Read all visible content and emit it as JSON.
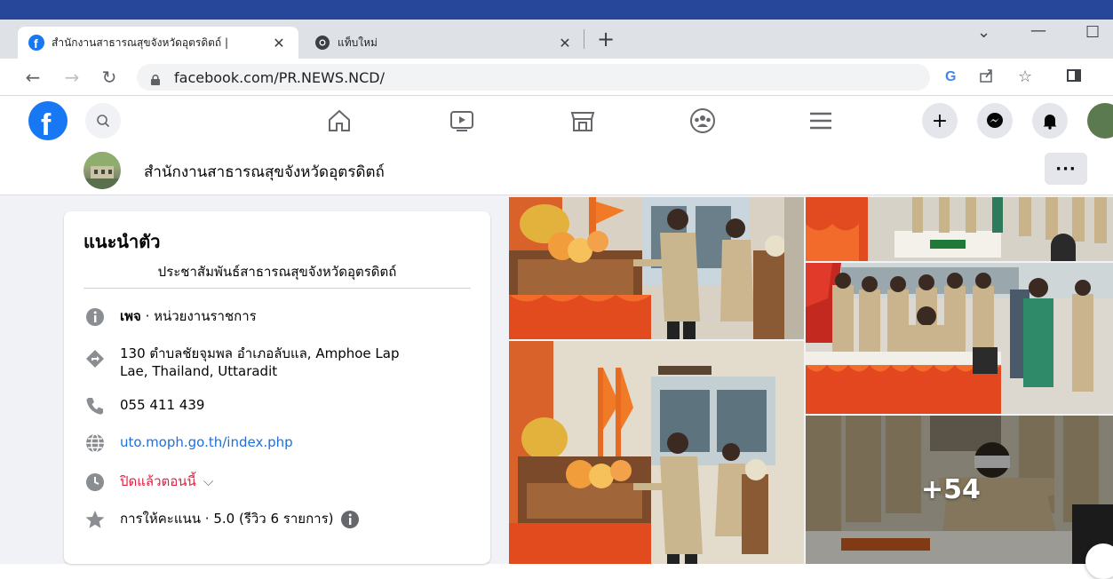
{
  "browser": {
    "tabs": [
      {
        "title": "สำนักงานสาธารณสุขจังหวัดอุตรดิตถ์ |",
        "close": "✕",
        "active": true
      },
      {
        "title": "แท็บใหม่",
        "close": "✕",
        "active": false
      }
    ],
    "new_tab": "+",
    "url": "facebook.com/PR.NEWS.NCD/"
  },
  "page": {
    "name": "สำนักงานสาธารณสุขจังหวัดอุตรดิตถ์",
    "more": "···"
  },
  "intro": {
    "title": "แนะนำตัว",
    "bio": "ประชาสัมพันธ์สาธารณสุขจังหวัดอุตรดิตถ์",
    "category_prefix": "เพจ",
    "category": " · หน่วยงานราชการ",
    "address_line1": "130 ตำบลชัยจุมพล อำเภอลับแล, Amphoe Lap",
    "address_line2": "Lae, Thailand, Uttaradit",
    "phone": "055 411 439",
    "website": "uto.moph.go.th/index.php",
    "hours": "ปิดแล้วตอนนี้",
    "rating": "การให้คะแนน · 5.0 (รีวิว 6 รายการ)"
  },
  "photos": {
    "more_count": "+54"
  },
  "colors": {
    "fb_blue": "#1877f2",
    "link": "#216fdb",
    "closed_red": "#e41e3f",
    "window_blue": "#27479b"
  },
  "icons": [
    "facebook-logo-icon",
    "search-icon",
    "home-icon",
    "watch-icon",
    "marketplace-icon",
    "groups-icon",
    "menu-icon",
    "plus-icon",
    "messenger-icon",
    "bell-icon",
    "info-icon",
    "directions-icon",
    "phone-icon",
    "globe-icon",
    "clock-icon",
    "star-icon"
  ]
}
